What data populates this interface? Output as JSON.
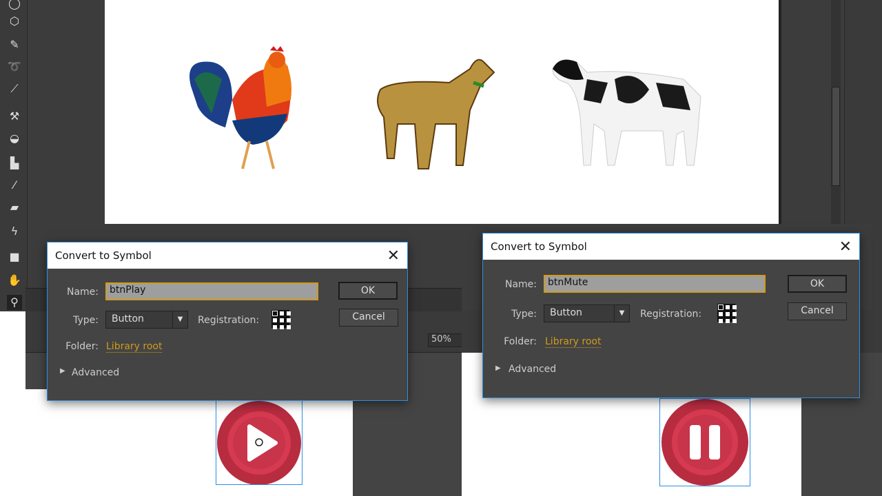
{
  "tools": [
    "oval-icon",
    "polystar-icon",
    "pencil-icon",
    "lasso-icon",
    "brush-icon",
    "bone-icon",
    "paint-bucket-icon",
    "ink-bottle-icon",
    "eyedropper-icon",
    "eraser-icon",
    "width-icon",
    "camera-icon",
    "hand-icon",
    "zoom-icon"
  ],
  "stage": {
    "zoom": "50%"
  },
  "dialogs": [
    {
      "title": "Convert to Symbol",
      "name_label": "Name:",
      "name_value": "btnPlay",
      "type_label": "Type:",
      "type_value": "Button",
      "registration_label": "Registration:",
      "folder_label": "Folder:",
      "folder_value": "Library root",
      "advanced_label": "Advanced",
      "ok_label": "OK",
      "cancel_label": "Cancel"
    },
    {
      "title": "Convert to Symbol",
      "name_label": "Name:",
      "name_value": "btnMute",
      "type_label": "Type:",
      "type_value": "Button",
      "registration_label": "Registration:",
      "folder_label": "Folder:",
      "folder_value": "Library root",
      "advanced_label": "Advanced",
      "ok_label": "OK",
      "cancel_label": "Cancel"
    }
  ],
  "colors": {
    "accent": "#d19b1a",
    "selection": "#2d8fe0",
    "button_red": "#c8344a"
  }
}
